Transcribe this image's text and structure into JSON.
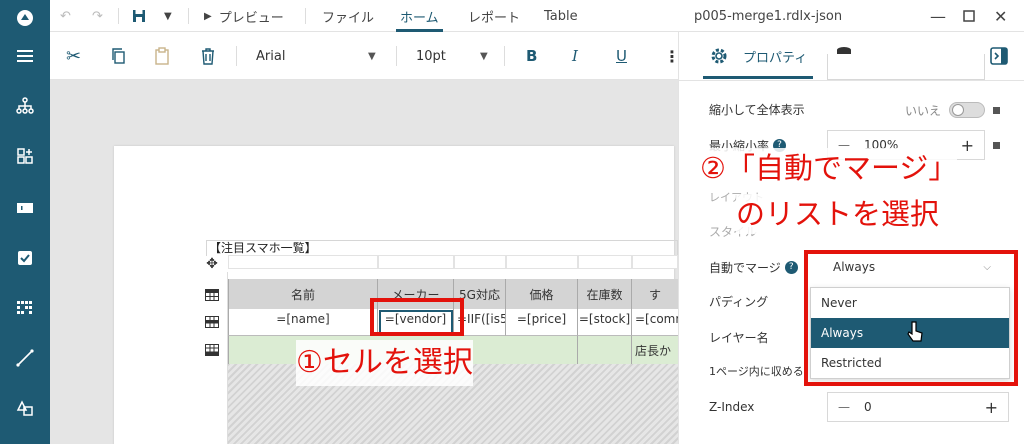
{
  "app": {
    "document_title": "p005-merge1.rdlx-json"
  },
  "topbar": {
    "preview_label": "プレビュー",
    "menus": [
      "ファイル",
      "ホーム",
      "レポート",
      "Table"
    ],
    "active_menu": "ホーム"
  },
  "toolbar": {
    "font_family": "Arial",
    "font_size": "10pt",
    "bold": "B",
    "italic": "I",
    "underline": "U"
  },
  "panel": {
    "title": "プロパティ",
    "rows": {
      "shrink_label": "縮小して全体表示",
      "shrink_value": "いいえ",
      "min_scale_label": "最小縮小率",
      "min_scale_value": "100%",
      "layout_section": "レイアウト",
      "style_section": "スタイル",
      "auto_merge_label": "自動でマージ",
      "auto_merge_value": "Always",
      "padding_label": "パディング",
      "layer_label": "レイヤー名",
      "fit_page_label": "1ページ内に収める",
      "zindex_label": "Z-Index",
      "zindex_value": "0"
    },
    "dropdown": {
      "options": [
        "Never",
        "Always",
        "Restricted"
      ],
      "selected": "Always"
    }
  },
  "report": {
    "title": "【注目スマホ一覧】",
    "headers": [
      "名前",
      "メーカー",
      "5G対応",
      "価格",
      "在庫数",
      "す"
    ],
    "body": [
      "=[name]",
      "=[vendor]",
      "=IIF([is5G]",
      "=[price]",
      "=[stock]",
      "=[comm"
    ],
    "footer_text": "店長か"
  },
  "annotations": {
    "step1": "①セルを選択",
    "step2_line1": "②「自動でマージ」",
    "step2_line2": "のリストを選択"
  },
  "colors": {
    "accent": "#1e5a73",
    "annotation": "#e3120b",
    "footer_row": "#dbecd3",
    "header_row": "#d4d4d4"
  }
}
